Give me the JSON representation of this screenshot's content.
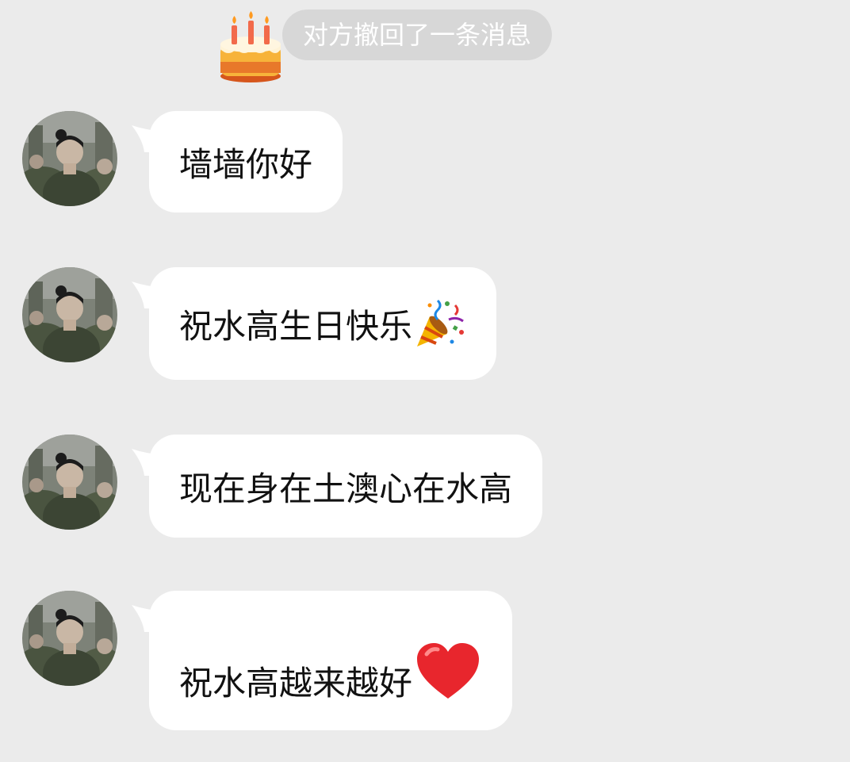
{
  "system_notice": {
    "icon": "birthday-cake-icon",
    "text": "对方撤回了一条消息"
  },
  "messages": [
    {
      "text": "墙墙你好",
      "emoji": ""
    },
    {
      "text": "祝水高生日快乐",
      "emoji": "party-popper-icon"
    },
    {
      "text": "现在身在土澳心在水高",
      "emoji": ""
    },
    {
      "text": "祝水高越来越好",
      "emoji": "red-heart-icon"
    }
  ],
  "colors": {
    "background": "#ebebeb",
    "bubble": "#ffffff",
    "recall_pill": "#d7d7d7",
    "heart": "#e8262d"
  }
}
